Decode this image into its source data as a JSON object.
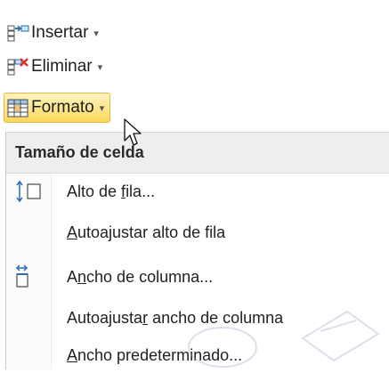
{
  "ribbon": {
    "insertar": {
      "label": "Insertar",
      "icon": "insert-cells-icon"
    },
    "eliminar": {
      "label": "Eliminar",
      "icon": "delete-cells-icon"
    },
    "formato": {
      "label": "Formato",
      "icon": "format-cells-icon"
    },
    "dropdown_glyph": "▾"
  },
  "menu": {
    "header": "Tamaño de celda",
    "items": [
      {
        "pre": "Alto de ",
        "ul": "f",
        "post": "ila...",
        "icon": "row-height-icon"
      },
      {
        "pre": "",
        "ul": "A",
        "post": "utoajustar alto de fila",
        "icon": ""
      },
      {
        "pre": "A",
        "ul": "n",
        "post": "cho de columna...",
        "icon": "column-width-icon"
      },
      {
        "pre": "Autoajusta",
        "ul": "r",
        "post": " ancho de columna",
        "icon": ""
      },
      {
        "pre": "",
        "ul": "A",
        "post": "ncho predeterminado...",
        "icon": ""
      }
    ]
  },
  "colors": {
    "highlight": "#fde58a",
    "highlight_border": "#e5b84a",
    "header_bg": "#eeeeee",
    "accent_red": "#d6342a",
    "accent_blue": "#2b6cb0"
  }
}
